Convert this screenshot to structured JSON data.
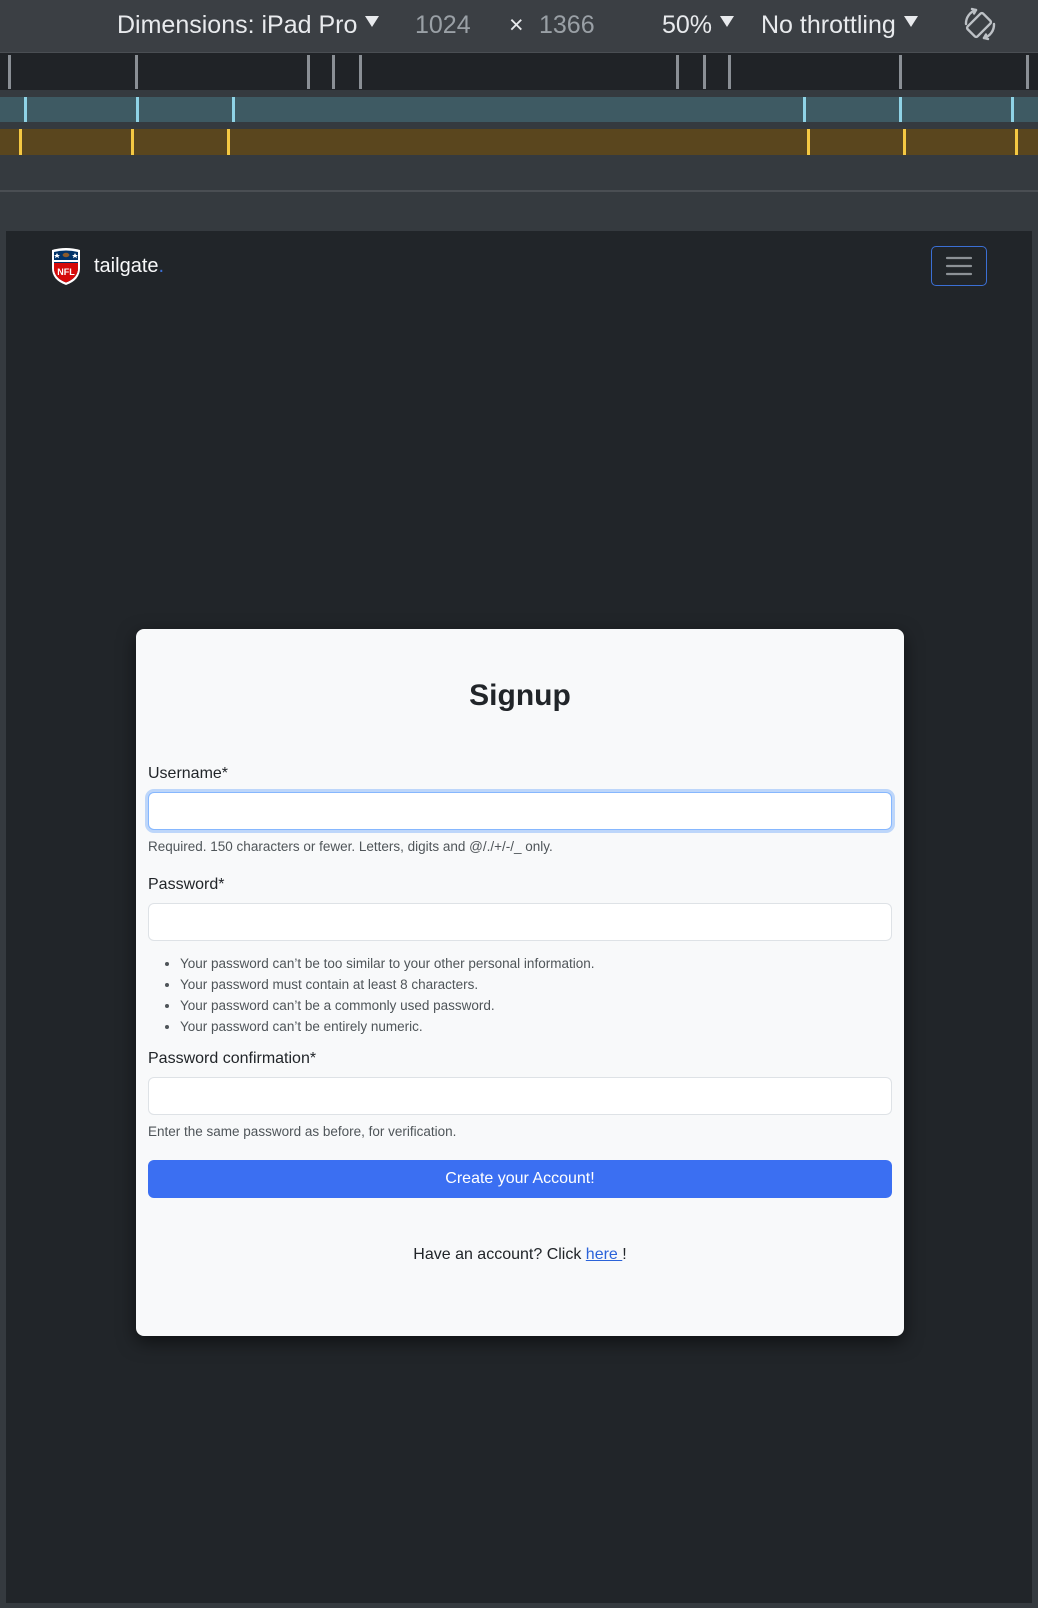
{
  "devtools": {
    "dimensions_label": "Dimensions: iPad Pro",
    "width": "1024",
    "times": "×",
    "height": "1366",
    "zoom": "50%",
    "throttling": "No throttling",
    "rotate_icon": "rotate-device-icon"
  },
  "navbar": {
    "brand_name": "tailgate",
    "brand_dot": ".",
    "logo_icon": "nfl-shield-logo",
    "toggler_icon": "hamburger-menu-icon"
  },
  "signup": {
    "title": "Signup",
    "username_label": "Username*",
    "username_value": "",
    "username_help": "Required. 150 characters or fewer. Letters, digits and @/./+/-/_ only.",
    "password_label": "Password*",
    "password_value": "",
    "password_rules": [
      "Your password can’t be too similar to your other personal information.",
      "Your password must contain at least 8 characters.",
      "Your password can’t be a commonly used password.",
      "Your password can’t be entirely numeric."
    ],
    "confirm_label": "Password confirmation*",
    "confirm_value": "",
    "confirm_help": "Enter the same password as before, for verification.",
    "submit_label": "Create your Account!",
    "login_prompt": "Have an account? Click ",
    "login_link": "here ",
    "login_suffix": "!"
  },
  "colors": {
    "page_bg": "#212529",
    "card_bg": "#f8f9fa",
    "primary": "#3b6ff2",
    "link": "#2b63d9"
  }
}
